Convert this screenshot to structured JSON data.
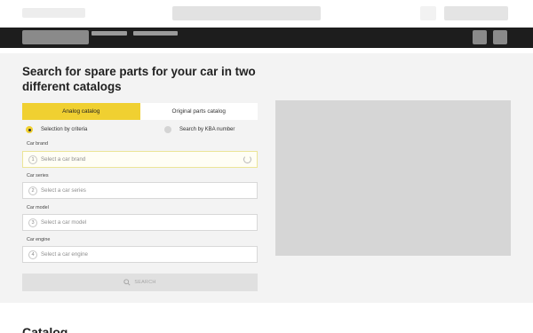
{
  "main": {
    "title": "Search for spare parts for your car in two different catalogs",
    "tabs": [
      {
        "label": "Analog catalog",
        "active": true
      },
      {
        "label": "Original parts catalog",
        "active": false
      }
    ],
    "radios": [
      {
        "label": "Selection by criteria",
        "selected": true
      },
      {
        "label": "Search by KBA number",
        "selected": false
      }
    ],
    "fields": [
      {
        "label": "Car brand",
        "number": "1",
        "placeholder": "Select a car brand",
        "loading": true
      },
      {
        "label": "Car series",
        "number": "2",
        "placeholder": "Select a car series"
      },
      {
        "label": "Car model",
        "number": "3",
        "placeholder": "Select a car model"
      },
      {
        "label": "Car engine",
        "number": "4",
        "placeholder": "Select a car engine"
      }
    ],
    "search_button": "SEARCH"
  },
  "catalog": {
    "title": "Catalog"
  },
  "colors": {
    "accent": "#f0d031",
    "nav_background": "#1d1d1d",
    "section_background": "#f3f3f3"
  }
}
